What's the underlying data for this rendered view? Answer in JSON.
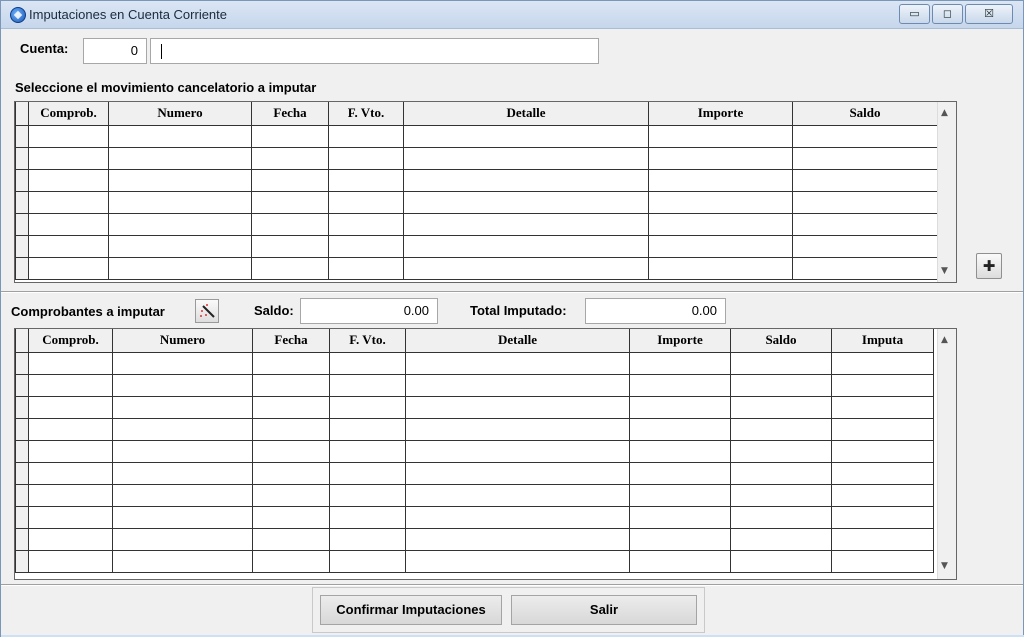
{
  "window": {
    "title": "Imputaciones en Cuenta Corriente",
    "minimize_glyph": "▭",
    "maximize_glyph": "◻",
    "close_glyph": "☒"
  },
  "cuenta": {
    "label": "Cuenta:",
    "code": "0",
    "name": ""
  },
  "movimientos": {
    "heading": "Seleccione el movimiento cancelatorio a imputar",
    "columns": [
      "Comprob.",
      "Numero",
      "Fecha",
      "F. Vto.",
      "Detalle",
      "Importe",
      "Saldo"
    ],
    "row_count": 7,
    "add_button_glyph": "✚"
  },
  "comprobantes": {
    "heading": "Comprobantes a imputar",
    "saldo_label": "Saldo:",
    "saldo_value": "0.00",
    "total_label": "Total Imputado:",
    "total_value": "0.00",
    "columns": [
      "Comprob.",
      "Numero",
      "Fecha",
      "F. Vto.",
      "Detalle",
      "Importe",
      "Saldo",
      "Imputa"
    ],
    "row_count": 10
  },
  "scroll": {
    "up_glyph": "▲",
    "down_glyph": "▼"
  },
  "buttons": {
    "confirm": "Confirmar Imputaciones",
    "exit": "Salir"
  }
}
